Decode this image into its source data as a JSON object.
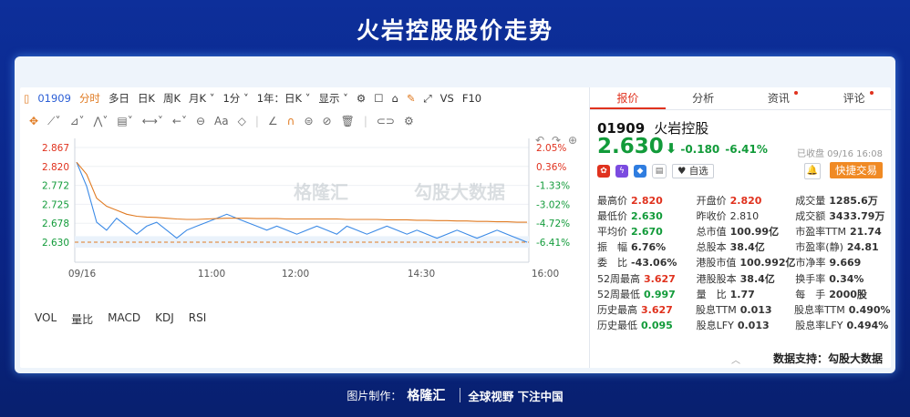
{
  "page": {
    "title": "火岩控股股价走势",
    "support": "数据支持：勾股大数据",
    "footer_label": "图片制作：",
    "footer_brand": "格隆汇",
    "footer_slogan": "全球视野 下注中国"
  },
  "toolbar": {
    "code": "01909",
    "items": [
      "分时",
      "多日",
      "日K",
      "周K",
      "月K ˅",
      "1分 ˅",
      "1年：日K ˅",
      "显示 ˅"
    ],
    "extra": [
      "VS",
      "F10"
    ]
  },
  "tools": [
    "Aa"
  ],
  "watermark": {
    "left": "格隆汇",
    "right": "勾股大数据"
  },
  "indicators": [
    "VOL",
    "量比",
    "MACD",
    "KDJ",
    "RSI"
  ],
  "quote": {
    "tabs": [
      {
        "label": "报价",
        "active": true,
        "dot": false
      },
      {
        "label": "分析",
        "active": false,
        "dot": false
      },
      {
        "label": "资讯",
        "active": false,
        "dot": true
      },
      {
        "label": "评论",
        "active": false,
        "dot": true
      }
    ],
    "code": "01909",
    "name": "火岩控股",
    "price": "2.630",
    "change": "-0.180",
    "change_pct": "-6.41%",
    "closed": "已收盘 09/16 16:08",
    "watchlist": "自选",
    "quick_trade": "快捷交易",
    "grid": [
      [
        [
          "最高价",
          "2.820",
          "red"
        ],
        [
          "开盘价",
          "2.820",
          "red"
        ],
        [
          "成交量",
          "1285.6万",
          "bold"
        ]
      ],
      [
        [
          "最低价",
          "2.630",
          "green"
        ],
        [
          "昨收价",
          "2.810",
          ""
        ],
        [
          "成交额",
          "3433.79万",
          "bold"
        ]
      ],
      [
        [
          "平均价",
          "2.670",
          "green"
        ],
        [
          "总市值",
          "100.99亿",
          "bold"
        ],
        [
          "市盈率TTM",
          "21.74",
          "bold"
        ]
      ],
      [
        [
          "振　幅",
          "6.76%",
          "bold"
        ],
        [
          "总股本",
          "38.4亿",
          "bold"
        ],
        [
          "市盈率(静)",
          "24.81",
          "bold"
        ]
      ],
      [
        [
          "委　比",
          "-43.06%",
          "bold"
        ],
        [
          "港股市值",
          "100.992亿",
          "bold"
        ],
        [
          "市净率",
          "9.669",
          "bold"
        ]
      ],
      [
        [
          "52周最高",
          "3.627",
          "red"
        ],
        [
          "港股股本",
          "38.4亿",
          "bold"
        ],
        [
          "换手率",
          "0.34%",
          "bold"
        ]
      ],
      [
        [
          "52周最低",
          "0.997",
          "green"
        ],
        [
          "量　比",
          "1.77",
          "bold"
        ],
        [
          "每　手",
          "2000股",
          "bold"
        ]
      ],
      [
        [
          "历史最高",
          "3.627",
          "red"
        ],
        [
          "股息TTM",
          "0.013",
          "bold"
        ],
        [
          "股息率TTM",
          "0.490%",
          "bold"
        ]
      ],
      [
        [
          "历史最低",
          "0.095",
          "green"
        ],
        [
          "股息LFY",
          "0.013",
          "bold"
        ],
        [
          "股息率LFY",
          "0.494%",
          "bold"
        ]
      ]
    ]
  },
  "chart_data": {
    "type": "line",
    "x_ticks": [
      "09/16",
      "11:00",
      "12:00",
      "14:30",
      "16:00"
    ],
    "y_left_ticks": [
      "2.867",
      "2.820",
      "2.772",
      "2.725",
      "2.678",
      "2.630"
    ],
    "y_right_ticks": [
      "2.05%",
      "0.36%",
      "-1.33%",
      "-3.02%",
      "-4.72%",
      "-6.41%"
    ],
    "ylim": [
      2.63,
      2.867
    ],
    "prev_close": 2.81,
    "series": [
      {
        "values": [
          2.83,
          2.77,
          2.68,
          2.66,
          2.69,
          2.67,
          2.65,
          2.67,
          2.68,
          2.66,
          2.64,
          2.66,
          2.67,
          2.68,
          2.69,
          2.7,
          2.69,
          2.68,
          2.67,
          2.66,
          2.67,
          2.66,
          2.65,
          2.66,
          2.67,
          2.66,
          2.65,
          2.67,
          2.66,
          2.65,
          2.66,
          2.67,
          2.66,
          2.65,
          2.66,
          2.65,
          2.64,
          2.65,
          2.66,
          2.65,
          2.64,
          2.65,
          2.66,
          2.65,
          2.64,
          2.63
        ]
      },
      {
        "values": [
          2.83,
          2.8,
          2.74,
          2.72,
          2.71,
          2.7,
          2.695,
          2.693,
          2.692,
          2.69,
          2.688,
          2.687,
          2.687,
          2.688,
          2.689,
          2.69,
          2.69,
          2.69,
          2.689,
          2.689,
          2.689,
          2.688,
          2.688,
          2.688,
          2.688,
          2.688,
          2.688,
          2.687,
          2.687,
          2.687,
          2.687,
          2.686,
          2.686,
          2.686,
          2.685,
          2.685,
          2.684,
          2.684,
          2.683,
          2.683,
          2.682,
          2.682,
          2.681,
          2.681,
          2.68,
          2.68
        ]
      }
    ]
  }
}
